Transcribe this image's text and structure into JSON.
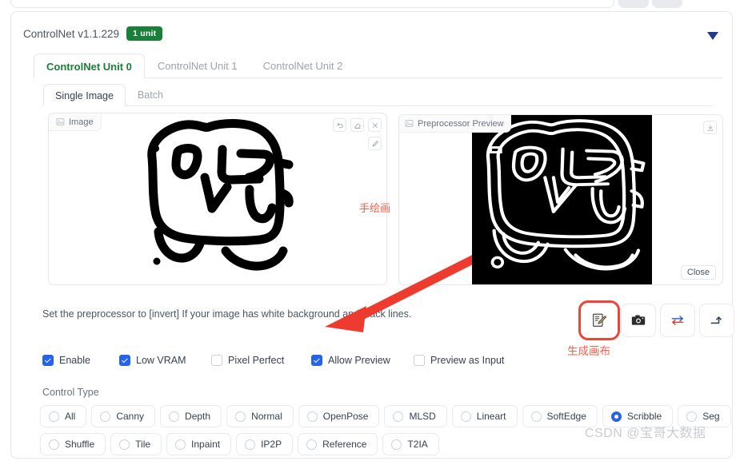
{
  "header": {
    "title": "ControlNet v1.1.229",
    "badge": "1 unit",
    "collapse_icon": "triangle-down-icon"
  },
  "unit_tabs": [
    {
      "label": "ControlNet Unit 0",
      "active": true
    },
    {
      "label": "ControlNet Unit 1",
      "active": false
    },
    {
      "label": "ControlNet Unit 2",
      "active": false
    }
  ],
  "sub_tabs": [
    {
      "label": "Single Image",
      "active": true
    },
    {
      "label": "Batch",
      "active": false
    }
  ],
  "image_panel": {
    "tag": "Image",
    "tag_icon": "image-icon",
    "tools": [
      {
        "name": "undo-icon",
        "title": "undo"
      },
      {
        "name": "eraser-icon",
        "title": "eraser"
      },
      {
        "name": "close-icon",
        "title": "remove"
      },
      {
        "name": "pen-icon",
        "title": "draw"
      }
    ]
  },
  "preprocessor_panel": {
    "tag": "Preprocessor Preview",
    "tag_icon": "image-icon",
    "download_icon": "download-icon",
    "close_label": "Close"
  },
  "hint": "Set the preprocessor to [invert] If your image has white background and black lines.",
  "actions": [
    {
      "name": "create-canvas-button",
      "icon": "memo-pencil-icon",
      "glyph": "📝",
      "highlighted": true
    },
    {
      "name": "webcam-button",
      "icon": "camera-icon",
      "glyph": "📷",
      "highlighted": false
    },
    {
      "name": "mirror-webcam-button",
      "icon": "swap-arrows-icon",
      "glyph": "⇄",
      "highlighted": false
    },
    {
      "name": "send-dimensions-button",
      "icon": "arrow-turn-icon",
      "glyph": "↱",
      "highlighted": false
    }
  ],
  "checkboxes": [
    {
      "label": "Enable",
      "checked": true
    },
    {
      "label": "Low VRAM",
      "checked": true
    },
    {
      "label": "Pixel Perfect",
      "checked": false
    },
    {
      "label": "Allow Preview",
      "checked": true
    },
    {
      "label": "Preview as Input",
      "checked": false
    }
  ],
  "control_type": {
    "label": "Control Type",
    "rows": [
      [
        {
          "label": "All",
          "selected": false
        },
        {
          "label": "Canny",
          "selected": false
        },
        {
          "label": "Depth",
          "selected": false
        },
        {
          "label": "Normal",
          "selected": false
        },
        {
          "label": "OpenPose",
          "selected": false
        },
        {
          "label": "MLSD",
          "selected": false
        },
        {
          "label": "Lineart",
          "selected": false
        },
        {
          "label": "SoftEdge",
          "selected": false
        },
        {
          "label": "Scribble",
          "selected": true
        },
        {
          "label": "Seg",
          "selected": false
        }
      ],
      [
        {
          "label": "Shuffle",
          "selected": false
        },
        {
          "label": "Tile",
          "selected": false
        },
        {
          "label": "Inpaint",
          "selected": false
        },
        {
          "label": "IP2P",
          "selected": false
        },
        {
          "label": "Reference",
          "selected": false
        },
        {
          "label": "T2IA",
          "selected": false
        }
      ]
    ]
  },
  "annotations": {
    "sketch_note": "手绘画",
    "canvas_note": "生成画布",
    "arrow_icon": "red-arrow-icon"
  },
  "watermark": "CSDN @宝哥大数据",
  "colors": {
    "accent_green": "#1a7f37",
    "accent_blue": "#2563eb",
    "annotation_red": "#f4614e",
    "border": "#e5e7eb"
  }
}
